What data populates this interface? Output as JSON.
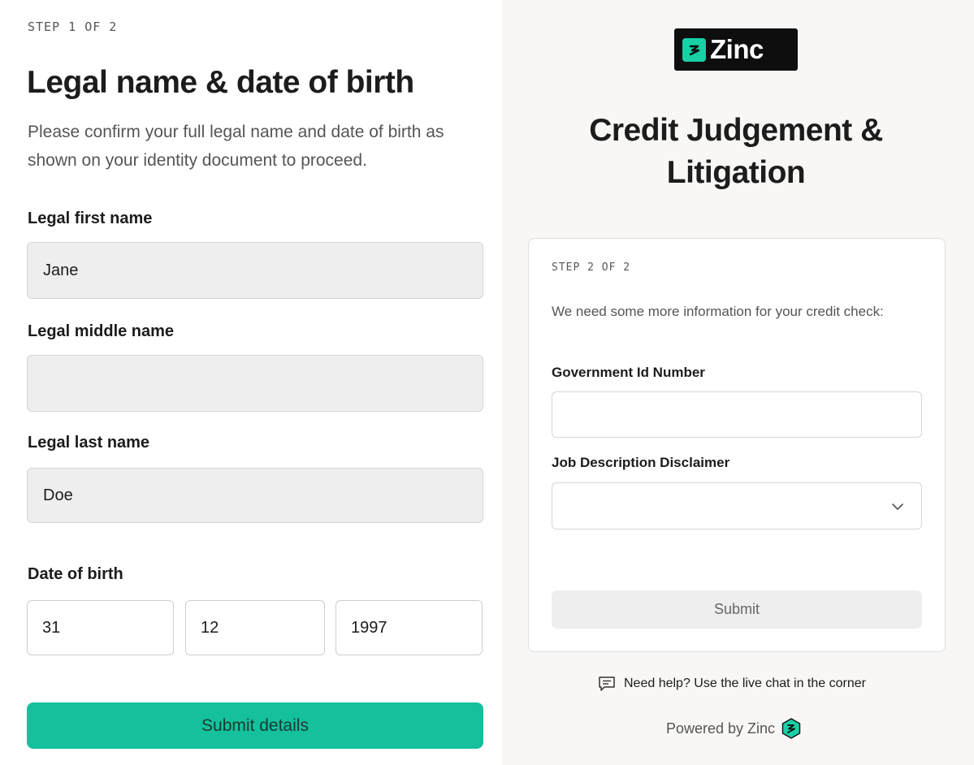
{
  "step1": {
    "step_label": "STEP 1 OF 2",
    "title": "Legal name & date of birth",
    "description": "Please confirm your full legal name and date of birth as shown on your identity document to proceed.",
    "first_name": {
      "label": "Legal first name",
      "value": "Jane"
    },
    "middle_name": {
      "label": "Legal middle name",
      "value": ""
    },
    "last_name": {
      "label": "Legal last name",
      "value": "Doe"
    },
    "dob": {
      "label": "Date of birth",
      "day": "31",
      "month": "12",
      "year": "1997"
    },
    "submit_label": "Submit details"
  },
  "step2": {
    "brand": "Zinc",
    "title": "Credit Judgement & Litigation",
    "step_label": "STEP 2 OF 2",
    "description": "We need some more information for your credit check:",
    "gov_id": {
      "label": "Government Id Number",
      "value": ""
    },
    "job_disclaimer": {
      "label": "Job Description Disclaimer",
      "selected": ""
    },
    "submit_label": "Submit",
    "help_text": "Need help? Use the live chat in the corner",
    "powered_by": "Powered by Zinc"
  },
  "colors": {
    "accent": "#14c19c",
    "brand_mark": "#17d1a5",
    "logo_bg": "#0e0e0e",
    "right_bg": "#f8f7f5"
  },
  "icons": [
    "zinc-logo-icon",
    "chat-icon",
    "chevron-down-icon",
    "zinc-hex-icon"
  ]
}
